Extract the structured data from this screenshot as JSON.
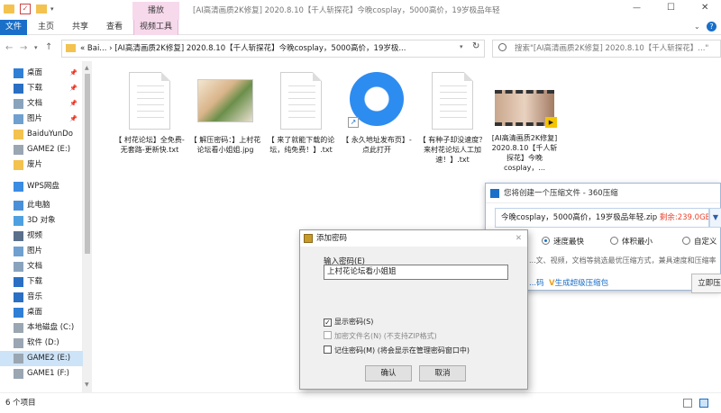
{
  "window": {
    "title": "[AI高清画质2K修复] 2020.8.10【千人斩探花】今晚cosplay，5000高价，19岁极品年轻",
    "minimize_glyph": "—",
    "maximize_glyph": "☐",
    "close_glyph": "✕"
  },
  "ribbon": {
    "context_header": "播放",
    "tabs": [
      "文件",
      "主页",
      "共享",
      "查看",
      "视频工具"
    ]
  },
  "address_bar": {
    "path": "«  Bai... › [AI高清画质2K修复] 2020.8.10【千人斩探花】今晚cosplay，5000高价，19岁极...",
    "search_placeholder": "搜索\"[AI高清画质2K修复] 2020.8.10【千人斩探花】...\""
  },
  "nav": {
    "items": [
      {
        "label": "桌面",
        "icon": "desktop-icon",
        "pinned": true
      },
      {
        "label": "下载",
        "icon": "download-icon",
        "pinned": true
      },
      {
        "label": "文档",
        "icon": "documents-icon",
        "pinned": true
      },
      {
        "label": "图片",
        "icon": "pictures-icon",
        "pinned": true
      },
      {
        "label": "BaiduYunDo",
        "icon": "folder-icon",
        "pinned": false
      },
      {
        "label": "GAME2 (E:)",
        "icon": "drive-icon",
        "pinned": false
      },
      {
        "label": "废片",
        "icon": "folder-icon",
        "pinned": false
      },
      {
        "label": "WPS网盘",
        "icon": "cloud-icon",
        "pinned": false
      },
      {
        "label": "此电脑",
        "icon": "computer-icon",
        "pinned": false
      },
      {
        "label": "3D 对象",
        "icon": "objects3d-icon",
        "pinned": false
      },
      {
        "label": "视频",
        "icon": "video-icon",
        "pinned": false
      },
      {
        "label": "图片",
        "icon": "pictures-icon",
        "pinned": false
      },
      {
        "label": "文档",
        "icon": "documents-icon",
        "pinned": false
      },
      {
        "label": "下载",
        "icon": "download-icon",
        "pinned": false
      },
      {
        "label": "音乐",
        "icon": "music-icon",
        "pinned": false
      },
      {
        "label": "桌面",
        "icon": "desktop-icon",
        "pinned": false
      },
      {
        "label": "本地磁盘 (C:)",
        "icon": "drive-icon",
        "pinned": false
      },
      {
        "label": "软件 (D:)",
        "icon": "drive-icon",
        "pinned": false
      },
      {
        "label": "GAME2 (E:)",
        "icon": "drive-icon",
        "pinned": false,
        "selected": true
      },
      {
        "label": "GAME1 (F:)",
        "icon": "drive-icon",
        "pinned": false
      }
    ]
  },
  "files": [
    {
      "name": "【 村花论坛】全免费-无套路-更新快.txt",
      "icon": "text-file-icon"
    },
    {
      "name": "【 解压密码：】上村花论坛看小姐姐.jpg",
      "icon": "image-file-icon"
    },
    {
      "name": "【 来了就能下载的论坛，纯免费！】.txt",
      "icon": "text-file-icon"
    },
    {
      "name": "【 永久地址发布页】-点此打开",
      "icon": "browser-shortcut-icon"
    },
    {
      "name": "【 有种子却没速度？来村花论坛人工加速！】.txt",
      "icon": "text-file-icon"
    },
    {
      "name": "[AI高清画质2K修复] 2020.8.10【千人斩探花】今晚cosplay，...",
      "icon": "video-file-icon"
    }
  ],
  "status_bar": {
    "item_count": "6 个项目"
  },
  "compress_dialog": {
    "title": "您将创建一个压缩文件 - 360压缩",
    "filename": "今晚cosplay，5000高价，19岁极品年轻.zip",
    "remaining": "剩余:239.0GB",
    "options": [
      "速度最快",
      "体积最小",
      "自定义"
    ],
    "selected_option": 0,
    "hint": "...文、视频，文档等挑选最优压缩方式，兼具速度和压缩率",
    "link_left": "...码",
    "link_right": "生成超级压缩包",
    "compress_button": "立即压"
  },
  "password_dialog": {
    "title": "添加密码",
    "close_glyph": "✕",
    "field_label": "输入密码(E)",
    "field_value": "上村花论坛看小姐姐",
    "show_password": "显示密码(S)",
    "encrypt_names": "加密文件名(N)",
    "encrypt_names_note": "(不支持ZIP格式)",
    "remember_password": "记住密码(M)",
    "remember_password_note": "(将会显示在管理密码窗口中)",
    "ok": "确认",
    "cancel": "取消"
  },
  "colors": {
    "accent": "#1a6fc8",
    "selection": "#cde3f7",
    "context_tab": "#f7d9ec",
    "warn": "#e8432d"
  }
}
